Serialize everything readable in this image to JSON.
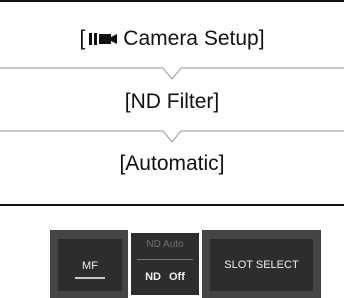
{
  "breadcrumb": {
    "step1_label": "Camera Setup]",
    "step1_open_bracket": "[",
    "step1_icon": "movie-camera-icon",
    "step2_label": "[ND Filter]",
    "step3_label": "[Automatic]"
  },
  "controls": {
    "mf_label": "MF",
    "nd_auto_label": "ND Auto",
    "nd_label": "ND",
    "nd_state": "Off",
    "slot_select_label": "SLOT SELECT"
  },
  "colors": {
    "panel_bg": "#454545",
    "button_bg": "#2d2d2d",
    "selected_border": "#ffffff"
  }
}
